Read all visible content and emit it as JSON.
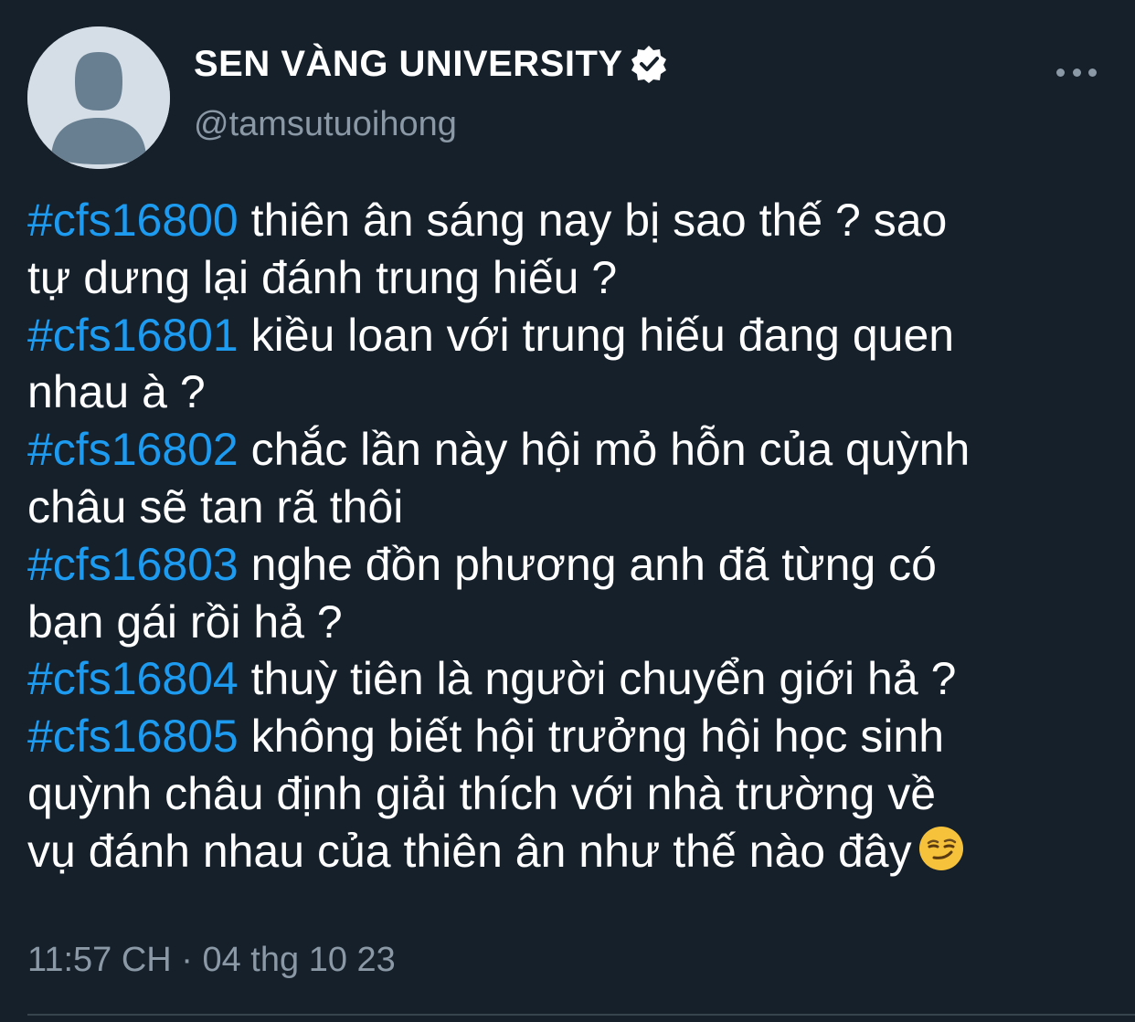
{
  "author": {
    "display_name": "SEN VÀNG UNIVERSITY",
    "handle": "@tamsutuoihong",
    "verified_icon": "verified-badge-icon",
    "avatar_icon": "default-avatar-icon"
  },
  "menu": {
    "icon": "more-options-icon"
  },
  "tweet": {
    "lines": [
      {
        "hashtag": "#cfs16800",
        "text": " thiên ân sáng nay bị sao thế ? sao"
      },
      {
        "hashtag": "",
        "text": "tự dưng lại đánh trung hiếu ?"
      },
      {
        "hashtag": "#cfs16801",
        "text": " kiều loan với trung hiếu đang quen"
      },
      {
        "hashtag": "",
        "text": "nhau à ?"
      },
      {
        "hashtag": "#cfs16802",
        "text": " chắc lần này hội mỏ hỗn của quỳnh"
      },
      {
        "hashtag": "",
        "text": "châu sẽ tan rã thôi"
      },
      {
        "hashtag": "#cfs16803",
        "text": " nghe đồn phương anh đã từng có"
      },
      {
        "hashtag": "",
        "text": "bạn gái rồi hả ?"
      },
      {
        "hashtag": "#cfs16804",
        "text": " thuỳ tiên là người chuyển giới hả ?"
      },
      {
        "hashtag": "#cfs16805",
        "text": " không biết hội trưởng hội học sinh"
      },
      {
        "hashtag": "",
        "text": "quỳnh châu định giải thích với nhà trường về"
      },
      {
        "hashtag": "",
        "text": "vụ đánh nhau của thiên ân như thế nào đây"
      }
    ],
    "emoji": "😏"
  },
  "meta": {
    "timestamp": "11:57 CH · 04 thg 10 23"
  },
  "colors": {
    "background": "#15202b",
    "text": "#ffffff",
    "secondary": "#8b98a5",
    "hashtag": "#1d9bf0",
    "divider": "#38444d"
  }
}
